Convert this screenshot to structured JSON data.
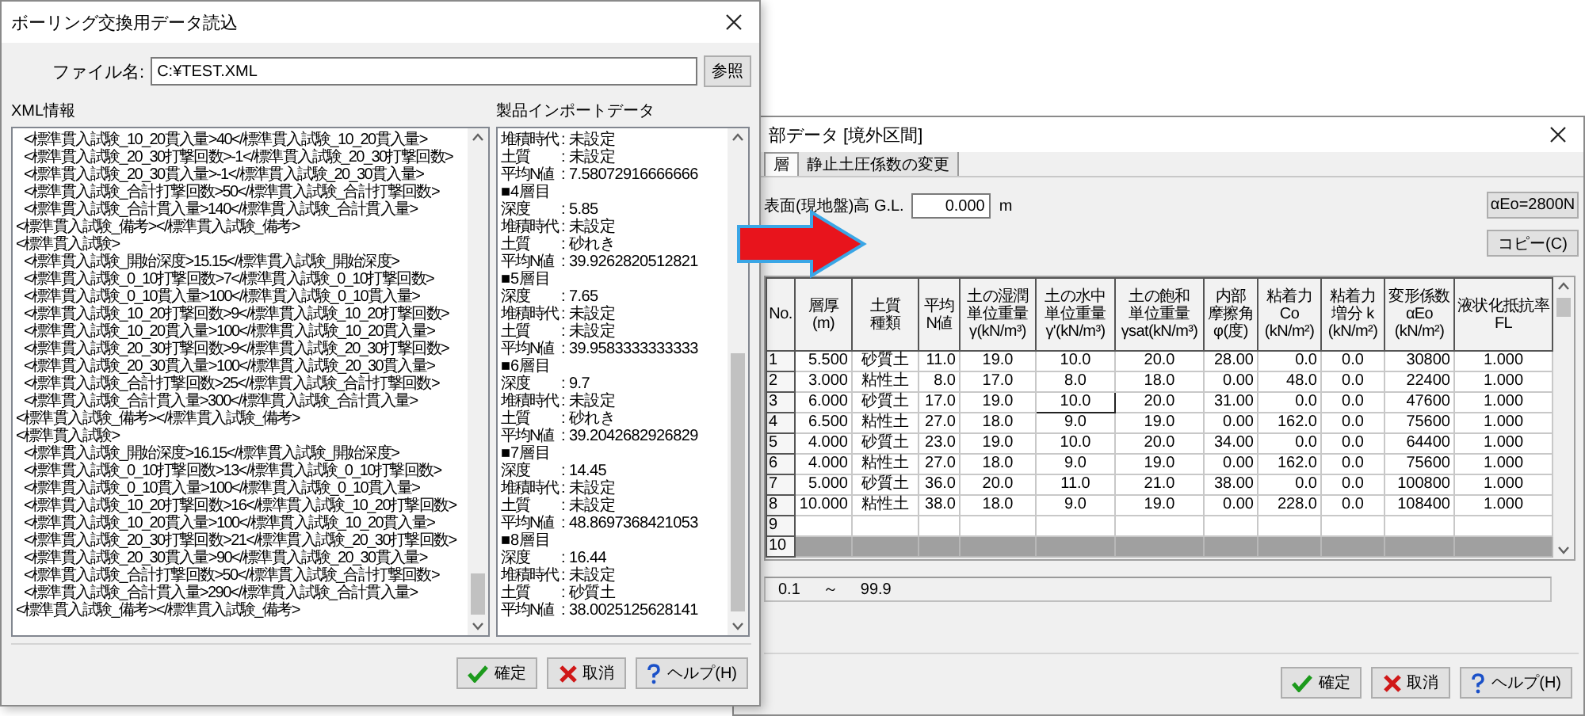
{
  "left_window": {
    "title": "ボーリング交換用データ読込",
    "file": {
      "label": "ファイル名:",
      "value": "C:¥TEST.XML",
      "browse_button": "参照"
    },
    "xml_info": {
      "label": "XML情報",
      "lines": [
        {
          "children": [
            {
              "text": "<標準貫入試験_10_20貫入量>40</標準貫入試験_10_20貫入量>"
            },
            {
              "text": "<標準貫入試験_20_30打撃回数>-1</標準貫入試験_20_30打撃回数>"
            },
            {
              "text": "<標準貫入試験_20_30貫入量>-1</標準貫入試験_20_30貫入量>"
            },
            {
              "text": "<標準貫入試験_合計打撃回数>50</標準貫入試験_合計打撃回数>"
            },
            {
              "text": "<標準貫入試験_合計貫入量>140</標準貫入試験_合計貫入量>"
            }
          ]
        },
        {
          "text": "<標準貫入試験_備考></標準貫入試験_備考>"
        },
        {
          "text": "<標準貫入試験>",
          "children": [
            {
              "text": "<標準貫入試験_開始深度>15.15</標準貫入試験_開始深度>"
            },
            {
              "text": "<標準貫入試験_0_10打撃回数>7</標準貫入試験_0_10打撃回数>"
            },
            {
              "text": "<標準貫入試験_0_10貫入量>100</標準貫入試験_0_10貫入量>"
            },
            {
              "text": "<標準貫入試験_10_20打撃回数>9</標準貫入試験_10_20打撃回数>"
            },
            {
              "text": "<標準貫入試験_10_20貫入量>100</標準貫入試験_10_20貫入量>"
            },
            {
              "text": "<標準貫入試験_20_30打撃回数>9</標準貫入試験_20_30打撃回数>"
            },
            {
              "text": "<標準貫入試験_20_30貫入量>100</標準貫入試験_20_30貫入量>"
            },
            {
              "text": "<標準貫入試験_合計打撃回数>25</標準貫入試験_合計打撃回数>"
            },
            {
              "text": "<標準貫入試験_合計貫入量>300</標準貫入試験_合計貫入量>"
            }
          ]
        },
        {
          "text": "<標準貫入試験_備考></標準貫入試験_備考>"
        },
        {
          "text": "<標準貫入試験>",
          "children": [
            {
              "text": "<標準貫入試験_開始深度>16.15</標準貫入試験_開始深度>"
            },
            {
              "text": "<標準貫入試験_0_10打撃回数>13</標準貫入試験_0_10打撃回数>"
            },
            {
              "text": "<標準貫入試験_0_10貫入量>100</標準貫入試験_0_10貫入量>"
            },
            {
              "text": "<標準貫入試験_10_20打撃回数>16</標準貫入試験_10_20打撃回数>"
            },
            {
              "text": "<標準貫入試験_10_20貫入量>100</標準貫入試験_10_20貫入量>"
            },
            {
              "text": "<標準貫入試験_20_30打撃回数>21</標準貫入試験_20_30打撃回数>"
            },
            {
              "text": "<標準貫入試験_20_30貫入量>90</標準貫入試験_20_30貫入量>"
            },
            {
              "text": "<標準貫入試験_合計打撃回数>50</標準貫入試験_合計打撃回数>"
            },
            {
              "text": "<標準貫入試験_合計貫入量>290</標準貫入試験_合計貫入量>"
            }
          ]
        },
        {
          "text": "<標準貫入試験_備考></標準貫入試験_備考>"
        }
      ]
    },
    "import_data": {
      "label": "製品インポートデータ",
      "lines": [
        {
          "kind": "field",
          "label": "堆積時代",
          "value": ": 未設定"
        },
        {
          "kind": "field",
          "label": "土質",
          "value": ": 未設定"
        },
        {
          "kind": "field",
          "label": "平均N値",
          "value": ": 7.58072916666666"
        },
        {
          "kind": "heading",
          "text": "■4層目"
        },
        {
          "kind": "field",
          "label": "深度",
          "value": ": 5.85"
        },
        {
          "kind": "field",
          "label": "堆積時代",
          "value": ": 未設定"
        },
        {
          "kind": "field",
          "label": "土質",
          "value": ": 砂れき"
        },
        {
          "kind": "field",
          "label": "平均N値",
          "value": ": 39.9262820512821"
        },
        {
          "kind": "heading",
          "text": "■5層目"
        },
        {
          "kind": "field",
          "label": "深度",
          "value": ": 7.65"
        },
        {
          "kind": "field",
          "label": "堆積時代",
          "value": ": 未設定"
        },
        {
          "kind": "field",
          "label": "土質",
          "value": ": 未設定"
        },
        {
          "kind": "field",
          "label": "平均N値",
          "value": ": 39.9583333333333"
        },
        {
          "kind": "heading",
          "text": "■6層目"
        },
        {
          "kind": "field",
          "label": "深度",
          "value": ": 9.7"
        },
        {
          "kind": "field",
          "label": "堆積時代",
          "value": ": 未設定"
        },
        {
          "kind": "field",
          "label": "土質",
          "value": ": 砂れき"
        },
        {
          "kind": "field",
          "label": "平均N値",
          "value": ": 39.2042682926829"
        },
        {
          "kind": "heading",
          "text": "■7層目"
        },
        {
          "kind": "field",
          "label": "深度",
          "value": ": 14.45"
        },
        {
          "kind": "field",
          "label": "堆積時代",
          "value": ": 未設定"
        },
        {
          "kind": "field",
          "label": "土質",
          "value": ": 未設定"
        },
        {
          "kind": "field",
          "label": "平均N値",
          "value": ": 48.8697368421053"
        },
        {
          "kind": "heading",
          "text": "■8層目"
        },
        {
          "kind": "field",
          "label": "深度",
          "value": ": 16.44"
        },
        {
          "kind": "field",
          "label": "堆積時代",
          "value": ": 未設定"
        },
        {
          "kind": "field",
          "label": "土質",
          "value": ": 砂質土"
        },
        {
          "kind": "field",
          "label": "平均N値",
          "value": ": 38.0025125628141"
        }
      ]
    },
    "buttons": [
      {
        "label": "確定",
        "kind": "ok"
      },
      {
        "label": "取消",
        "kind": "cancel"
      },
      {
        "label": "ヘルプ(H)",
        "kind": "help"
      }
    ]
  },
  "right_window": {
    "title": "部データ [境外区間]",
    "tabs": [
      {
        "label": "層",
        "selected": true
      },
      {
        "label": "静止土圧係数の変更",
        "selected": false
      }
    ],
    "ground_level": {
      "label": "表面(現地盤)高 G.L.",
      "value": "0.000",
      "unit": "m"
    },
    "side_buttons": [
      "αEo=2800N",
      "コピー(C)"
    ],
    "table": {
      "columns": [
        {
          "lines": [
            "No."
          ]
        },
        {
          "lines": [
            "層厚",
            "(m)"
          ]
        },
        {
          "lines": [
            "土質",
            "種類"
          ]
        },
        {
          "lines": [
            "平均",
            "N値"
          ]
        },
        {
          "lines": [
            "土の湿潤",
            "単位重量",
            "γ(kN/m³)"
          ]
        },
        {
          "lines": [
            "土の水中",
            "単位重量",
            "γ'(kN/m³)"
          ]
        },
        {
          "lines": [
            "土の飽和",
            "単位重量",
            "γsat(kN/m³)"
          ]
        },
        {
          "lines": [
            "内部",
            "摩擦角",
            "φ(度)"
          ]
        },
        {
          "lines": [
            "粘着力",
            "Co",
            "(kN/m²)"
          ]
        },
        {
          "lines": [
            "粘着力",
            "増分 k",
            "(kN/m²)"
          ]
        },
        {
          "lines": [
            "変形係数",
            "αEo",
            "(kN/m²)"
          ]
        },
        {
          "lines": [
            "液状化抵抗率",
            "FL"
          ]
        }
      ],
      "rows": [
        {
          "no": "1",
          "disabled": false,
          "cells": [
            {
              "text": "5.500",
              "selected": false
            },
            {
              "text": "砂質土",
              "selected": false
            },
            {
              "text": "11.0",
              "selected": false
            },
            {
              "text": "19.0",
              "selected": false
            },
            {
              "text": "10.0",
              "selected": false
            },
            {
              "text": "20.0",
              "selected": false
            },
            {
              "text": "28.00",
              "selected": false
            },
            {
              "text": "0.0",
              "selected": false
            },
            {
              "text": "0.0",
              "selected": false
            },
            {
              "text": "30800",
              "selected": false
            },
            {
              "text": "1.000",
              "selected": false
            }
          ]
        },
        {
          "no": "2",
          "disabled": false,
          "cells": [
            {
              "text": "3.000",
              "selected": false
            },
            {
              "text": "粘性土",
              "selected": false
            },
            {
              "text": "8.0",
              "selected": false
            },
            {
              "text": "17.0",
              "selected": false
            },
            {
              "text": "8.0",
              "selected": false
            },
            {
              "text": "18.0",
              "selected": false
            },
            {
              "text": "0.00",
              "selected": false
            },
            {
              "text": "48.0",
              "selected": false
            },
            {
              "text": "0.0",
              "selected": false
            },
            {
              "text": "22400",
              "selected": false
            },
            {
              "text": "1.000",
              "selected": false
            }
          ]
        },
        {
          "no": "3",
          "disabled": false,
          "cells": [
            {
              "text": "6.000",
              "selected": false
            },
            {
              "text": "砂質土",
              "selected": false
            },
            {
              "text": "17.0",
              "selected": false
            },
            {
              "text": "19.0",
              "selected": false
            },
            {
              "text": "10.0",
              "selected": true
            },
            {
              "text": "20.0",
              "selected": false
            },
            {
              "text": "31.00",
              "selected": false
            },
            {
              "text": "0.0",
              "selected": false
            },
            {
              "text": "0.0",
              "selected": false
            },
            {
              "text": "47600",
              "selected": false
            },
            {
              "text": "1.000",
              "selected": false
            }
          ]
        },
        {
          "no": "4",
          "disabled": false,
          "cells": [
            {
              "text": "6.500",
              "selected": false
            },
            {
              "text": "粘性土",
              "selected": false
            },
            {
              "text": "27.0",
              "selected": false
            },
            {
              "text": "18.0",
              "selected": false
            },
            {
              "text": "9.0",
              "selected": false
            },
            {
              "text": "19.0",
              "selected": false
            },
            {
              "text": "0.00",
              "selected": false
            },
            {
              "text": "162.0",
              "selected": false
            },
            {
              "text": "0.0",
              "selected": false
            },
            {
              "text": "75600",
              "selected": false
            },
            {
              "text": "1.000",
              "selected": false
            }
          ]
        },
        {
          "no": "5",
          "disabled": false,
          "cells": [
            {
              "text": "4.000",
              "selected": false
            },
            {
              "text": "砂質土",
              "selected": false
            },
            {
              "text": "23.0",
              "selected": false
            },
            {
              "text": "19.0",
              "selected": false
            },
            {
              "text": "10.0",
              "selected": false
            },
            {
              "text": "20.0",
              "selected": false
            },
            {
              "text": "34.00",
              "selected": false
            },
            {
              "text": "0.0",
              "selected": false
            },
            {
              "text": "0.0",
              "selected": false
            },
            {
              "text": "64400",
              "selected": false
            },
            {
              "text": "1.000",
              "selected": false
            }
          ]
        },
        {
          "no": "6",
          "disabled": false,
          "cells": [
            {
              "text": "4.000",
              "selected": false
            },
            {
              "text": "粘性土",
              "selected": false
            },
            {
              "text": "27.0",
              "selected": false
            },
            {
              "text": "18.0",
              "selected": false
            },
            {
              "text": "9.0",
              "selected": false
            },
            {
              "text": "19.0",
              "selected": false
            },
            {
              "text": "0.00",
              "selected": false
            },
            {
              "text": "162.0",
              "selected": false
            },
            {
              "text": "0.0",
              "selected": false
            },
            {
              "text": "75600",
              "selected": false
            },
            {
              "text": "1.000",
              "selected": false
            }
          ]
        },
        {
          "no": "7",
          "disabled": false,
          "cells": [
            {
              "text": "5.000",
              "selected": false
            },
            {
              "text": "砂質土",
              "selected": false
            },
            {
              "text": "36.0",
              "selected": false
            },
            {
              "text": "20.0",
              "selected": false
            },
            {
              "text": "11.0",
              "selected": false
            },
            {
              "text": "21.0",
              "selected": false
            },
            {
              "text": "38.00",
              "selected": false
            },
            {
              "text": "0.0",
              "selected": false
            },
            {
              "text": "0.0",
              "selected": false
            },
            {
              "text": "100800",
              "selected": false
            },
            {
              "text": "1.000",
              "selected": false
            }
          ]
        },
        {
          "no": "8",
          "disabled": false,
          "cells": [
            {
              "text": "10.000",
              "selected": false
            },
            {
              "text": "粘性土",
              "selected": false
            },
            {
              "text": "38.0",
              "selected": false
            },
            {
              "text": "18.0",
              "selected": false
            },
            {
              "text": "9.0",
              "selected": false
            },
            {
              "text": "19.0",
              "selected": false
            },
            {
              "text": "0.00",
              "selected": false
            },
            {
              "text": "228.0",
              "selected": false
            },
            {
              "text": "0.0",
              "selected": false
            },
            {
              "text": "108400",
              "selected": false
            },
            {
              "text": "1.000",
              "selected": false
            }
          ]
        },
        {
          "no": "9",
          "disabled": false
        },
        {
          "no": "10",
          "disabled": true
        }
      ]
    },
    "range": {
      "min": "0.1",
      "separator": "～",
      "max": "99.9"
    },
    "buttons": [
      {
        "label": "確定",
        "kind": "ok"
      },
      {
        "label": "取消",
        "kind": "cancel"
      },
      {
        "label": "ヘルプ(H)",
        "kind": "help"
      }
    ]
  }
}
